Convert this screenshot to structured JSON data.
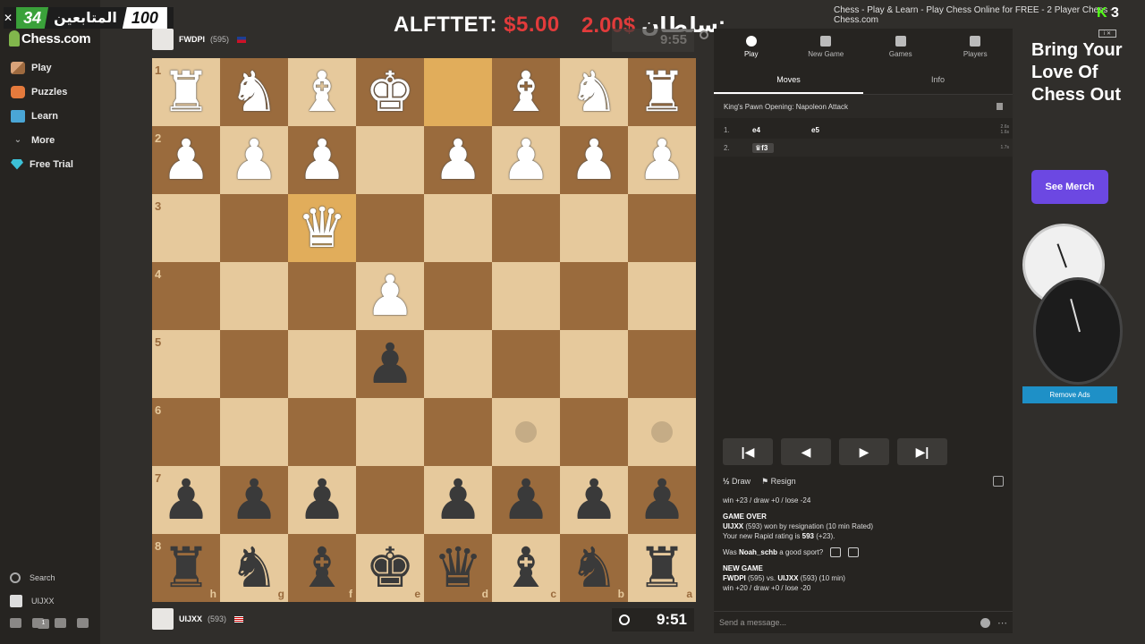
{
  "window": {
    "title": "Chess - Play & Learn - Play Chess Online for FREE - 2 Player Chess - Chess.com"
  },
  "overlay": {
    "followers_count": "34",
    "followers_label": "المتابعين",
    "followers_goal": "100",
    "donation_name": "ALFTTET:",
    "donation_amount": "$5.00",
    "donation2_amount": "2.00$",
    "donation2_name": "سلطان:",
    "k_badge_letter": "K",
    "k_badge_num": "3"
  },
  "sidebar": {
    "logo": "Chess.com",
    "items": [
      {
        "label": "Play",
        "icon": "pawn-play-icon"
      },
      {
        "label": "Puzzles",
        "icon": "puzzle-icon"
      },
      {
        "label": "Learn",
        "icon": "learn-cap-icon"
      },
      {
        "label": "More",
        "icon": "chevron-down-icon"
      },
      {
        "label": "Free Trial",
        "icon": "diamond-icon"
      }
    ],
    "search_label": "Search",
    "user_label": "UIJXX",
    "notification_count": "1"
  },
  "top_player": {
    "name": "FWDPI",
    "rating": "(595)",
    "clock": "9:55"
  },
  "bottom_player": {
    "name": "UIJXX",
    "rating": "(593)",
    "clock": "9:51"
  },
  "board": {
    "ranks": [
      "1",
      "2",
      "3",
      "4",
      "5",
      "6",
      "7",
      "8"
    ],
    "files": [
      "h",
      "g",
      "f",
      "e",
      "d",
      "c",
      "b",
      "a"
    ],
    "rows": [
      [
        "♜",
        "♞",
        "♝",
        "♚",
        "",
        "♝",
        "♞",
        "♜"
      ],
      [
        "♟",
        "♟",
        "♟",
        "",
        "♟",
        "♟",
        "♟",
        "♟"
      ],
      [
        "",
        "",
        "♛",
        "",
        "",
        "",
        "",
        ""
      ],
      [
        "",
        "",
        "",
        "♟",
        "",
        "",
        "",
        ""
      ],
      [
        "",
        "",
        "",
        "♟",
        "",
        "",
        "",
        ""
      ],
      [
        "",
        "",
        "",
        "",
        "",
        "",
        "",
        ""
      ],
      [
        "♟",
        "♟",
        "♟",
        "",
        "♟",
        "♟",
        "♟",
        "♟"
      ],
      [
        "♜",
        "♞",
        "♝",
        "♚",
        "♛",
        "♝",
        "♞",
        "♜"
      ]
    ],
    "colors": [
      [
        "w",
        "w",
        "w",
        "w",
        "",
        "w",
        "w",
        "w"
      ],
      [
        "w",
        "w",
        "w",
        "",
        "w",
        "w",
        "w",
        "w"
      ],
      [
        "",
        "",
        "w",
        "",
        "",
        "",
        "",
        ""
      ],
      [
        "",
        "",
        "",
        "w",
        "",
        "",
        "",
        ""
      ],
      [
        "",
        "",
        "",
        "b",
        "",
        "",
        "",
        ""
      ],
      [
        "",
        "",
        "",
        "",
        "",
        "",
        "",
        ""
      ],
      [
        "b",
        "b",
        "b",
        "",
        "b",
        "b",
        "b",
        "b"
      ],
      [
        "b",
        "b",
        "b",
        "b",
        "b",
        "b",
        "b",
        "b"
      ]
    ]
  },
  "panel": {
    "tabs": [
      {
        "label": "Play",
        "icon": "stopwatch-icon"
      },
      {
        "label": "New Game",
        "icon": "plus-square-icon"
      },
      {
        "label": "Games",
        "icon": "grid-icon"
      },
      {
        "label": "Players",
        "icon": "users-icon"
      }
    ],
    "subtabs": [
      "Moves",
      "Info"
    ],
    "opening": "King's Pawn Opening: Napoleon Attack",
    "moves": [
      {
        "num": "1.",
        "white": "e4",
        "black": "e5",
        "times": "2.6s 1.6s"
      },
      {
        "num": "2.",
        "white": "♛f3",
        "black": "",
        "times": "1.7s"
      }
    ],
    "controls": [
      "|◀",
      "◀",
      "▶",
      "▶|"
    ],
    "draw_label": "Draw",
    "resign_label": "Resign",
    "chat": {
      "line1": "win +23 / draw +0 / lose -24",
      "game_over": "GAME OVER",
      "result_name": "UIJXX",
      "result_text": "(593) won by resignation (10 min Rated)",
      "rating_text_pre": "Your new Rapid rating is",
      "rating_value": "593",
      "rating_text_post": "(+23).",
      "sport_pre": "Was",
      "sport_name": "Noah_schb",
      "sport_post": "a good sport?",
      "new_game": "NEW GAME",
      "ng_p1": "FWDPI",
      "ng_mid": "(595) vs.",
      "ng_p2": "UIJXX",
      "ng_post": "(593) (10 min)",
      "line_last": "win +20 / draw +0 / lose -20"
    },
    "message_placeholder": "Send a message..."
  },
  "ad": {
    "headline": "Bring Your Love Of Chess Out",
    "button": "See Merch",
    "remove_ads": "Remove Ads"
  }
}
